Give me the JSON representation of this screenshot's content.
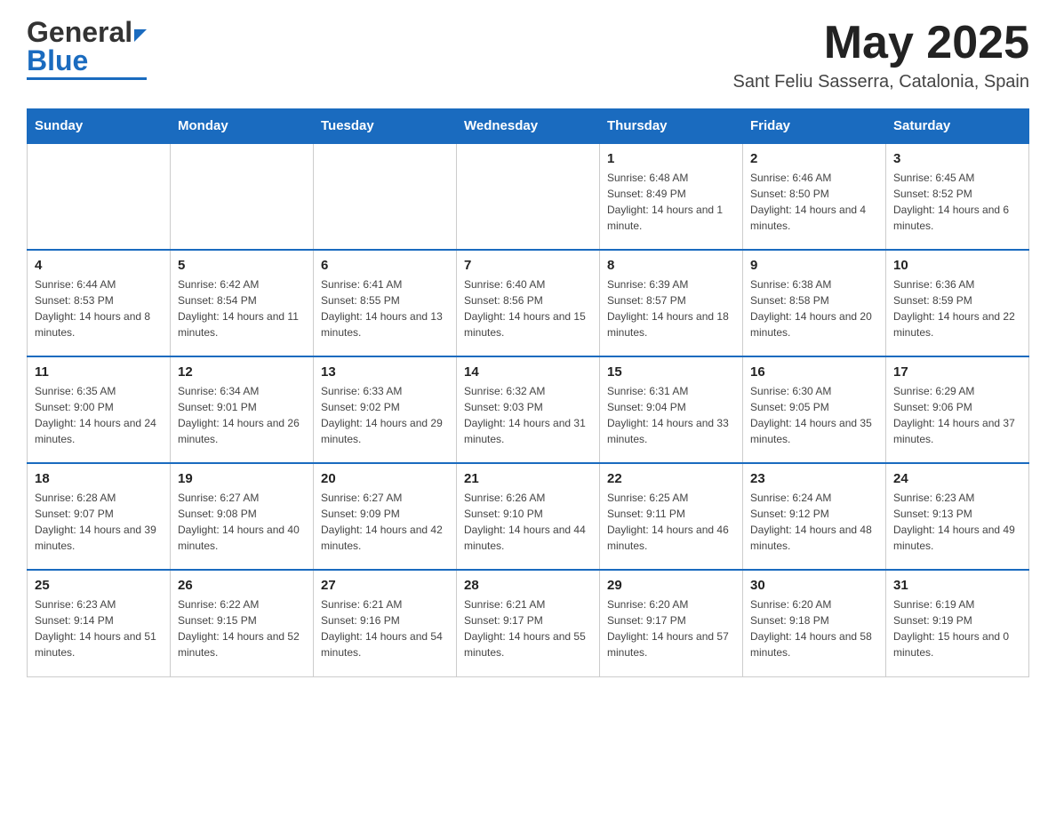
{
  "header": {
    "logo_general": "General",
    "logo_blue": "Blue",
    "month_title": "May 2025",
    "location": "Sant Feliu Sasserra, Catalonia, Spain"
  },
  "weekdays": [
    "Sunday",
    "Monday",
    "Tuesday",
    "Wednesday",
    "Thursday",
    "Friday",
    "Saturday"
  ],
  "weeks": [
    [
      {
        "day": "",
        "info": ""
      },
      {
        "day": "",
        "info": ""
      },
      {
        "day": "",
        "info": ""
      },
      {
        "day": "",
        "info": ""
      },
      {
        "day": "1",
        "info": "Sunrise: 6:48 AM\nSunset: 8:49 PM\nDaylight: 14 hours and 1 minute."
      },
      {
        "day": "2",
        "info": "Sunrise: 6:46 AM\nSunset: 8:50 PM\nDaylight: 14 hours and 4 minutes."
      },
      {
        "day": "3",
        "info": "Sunrise: 6:45 AM\nSunset: 8:52 PM\nDaylight: 14 hours and 6 minutes."
      }
    ],
    [
      {
        "day": "4",
        "info": "Sunrise: 6:44 AM\nSunset: 8:53 PM\nDaylight: 14 hours and 8 minutes."
      },
      {
        "day": "5",
        "info": "Sunrise: 6:42 AM\nSunset: 8:54 PM\nDaylight: 14 hours and 11 minutes."
      },
      {
        "day": "6",
        "info": "Sunrise: 6:41 AM\nSunset: 8:55 PM\nDaylight: 14 hours and 13 minutes."
      },
      {
        "day": "7",
        "info": "Sunrise: 6:40 AM\nSunset: 8:56 PM\nDaylight: 14 hours and 15 minutes."
      },
      {
        "day": "8",
        "info": "Sunrise: 6:39 AM\nSunset: 8:57 PM\nDaylight: 14 hours and 18 minutes."
      },
      {
        "day": "9",
        "info": "Sunrise: 6:38 AM\nSunset: 8:58 PM\nDaylight: 14 hours and 20 minutes."
      },
      {
        "day": "10",
        "info": "Sunrise: 6:36 AM\nSunset: 8:59 PM\nDaylight: 14 hours and 22 minutes."
      }
    ],
    [
      {
        "day": "11",
        "info": "Sunrise: 6:35 AM\nSunset: 9:00 PM\nDaylight: 14 hours and 24 minutes."
      },
      {
        "day": "12",
        "info": "Sunrise: 6:34 AM\nSunset: 9:01 PM\nDaylight: 14 hours and 26 minutes."
      },
      {
        "day": "13",
        "info": "Sunrise: 6:33 AM\nSunset: 9:02 PM\nDaylight: 14 hours and 29 minutes."
      },
      {
        "day": "14",
        "info": "Sunrise: 6:32 AM\nSunset: 9:03 PM\nDaylight: 14 hours and 31 minutes."
      },
      {
        "day": "15",
        "info": "Sunrise: 6:31 AM\nSunset: 9:04 PM\nDaylight: 14 hours and 33 minutes."
      },
      {
        "day": "16",
        "info": "Sunrise: 6:30 AM\nSunset: 9:05 PM\nDaylight: 14 hours and 35 minutes."
      },
      {
        "day": "17",
        "info": "Sunrise: 6:29 AM\nSunset: 9:06 PM\nDaylight: 14 hours and 37 minutes."
      }
    ],
    [
      {
        "day": "18",
        "info": "Sunrise: 6:28 AM\nSunset: 9:07 PM\nDaylight: 14 hours and 39 minutes."
      },
      {
        "day": "19",
        "info": "Sunrise: 6:27 AM\nSunset: 9:08 PM\nDaylight: 14 hours and 40 minutes."
      },
      {
        "day": "20",
        "info": "Sunrise: 6:27 AM\nSunset: 9:09 PM\nDaylight: 14 hours and 42 minutes."
      },
      {
        "day": "21",
        "info": "Sunrise: 6:26 AM\nSunset: 9:10 PM\nDaylight: 14 hours and 44 minutes."
      },
      {
        "day": "22",
        "info": "Sunrise: 6:25 AM\nSunset: 9:11 PM\nDaylight: 14 hours and 46 minutes."
      },
      {
        "day": "23",
        "info": "Sunrise: 6:24 AM\nSunset: 9:12 PM\nDaylight: 14 hours and 48 minutes."
      },
      {
        "day": "24",
        "info": "Sunrise: 6:23 AM\nSunset: 9:13 PM\nDaylight: 14 hours and 49 minutes."
      }
    ],
    [
      {
        "day": "25",
        "info": "Sunrise: 6:23 AM\nSunset: 9:14 PM\nDaylight: 14 hours and 51 minutes."
      },
      {
        "day": "26",
        "info": "Sunrise: 6:22 AM\nSunset: 9:15 PM\nDaylight: 14 hours and 52 minutes."
      },
      {
        "day": "27",
        "info": "Sunrise: 6:21 AM\nSunset: 9:16 PM\nDaylight: 14 hours and 54 minutes."
      },
      {
        "day": "28",
        "info": "Sunrise: 6:21 AM\nSunset: 9:17 PM\nDaylight: 14 hours and 55 minutes."
      },
      {
        "day": "29",
        "info": "Sunrise: 6:20 AM\nSunset: 9:17 PM\nDaylight: 14 hours and 57 minutes."
      },
      {
        "day": "30",
        "info": "Sunrise: 6:20 AM\nSunset: 9:18 PM\nDaylight: 14 hours and 58 minutes."
      },
      {
        "day": "31",
        "info": "Sunrise: 6:19 AM\nSunset: 9:19 PM\nDaylight: 15 hours and 0 minutes."
      }
    ]
  ],
  "colors": {
    "header_bg": "#1a6bbf",
    "header_text": "#ffffff",
    "border_top": "#1a6bbf",
    "cell_border": "#cccccc"
  }
}
